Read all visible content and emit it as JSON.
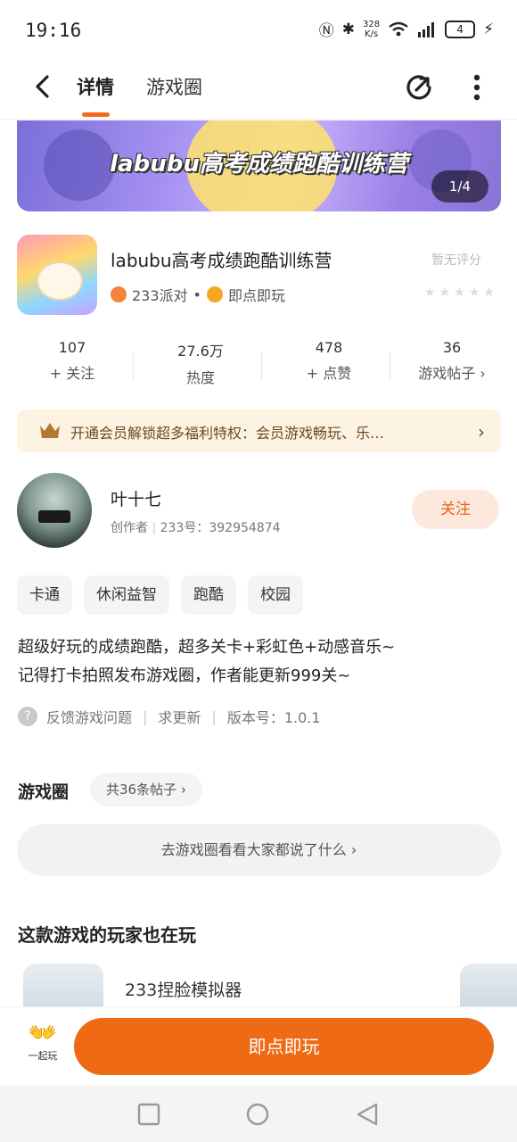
{
  "status_bar": {
    "time": "19:16",
    "net_speed_value": "328",
    "net_speed_unit": "K/s",
    "battery": "4"
  },
  "nav": {
    "tab_details": "详情",
    "tab_circle": "游戏圈"
  },
  "banner": {
    "title": "labubu高考成绩跑酷训练营",
    "counter": "1/4"
  },
  "game": {
    "title": "labubu高考成绩跑酷训练营",
    "rating": "暂无评分",
    "publisher": "233派对",
    "dot": "•",
    "play_mode": "即点即玩"
  },
  "stats": [
    {
      "value": "107",
      "label": "关注",
      "prefix": "+"
    },
    {
      "value": "27.6万",
      "label": "热度",
      "prefix": ""
    },
    {
      "value": "478",
      "label": "点赞",
      "prefix": "+"
    },
    {
      "value": "36",
      "label": "游戏帖子",
      "prefix": ""
    }
  ],
  "vip": {
    "text": "开通会员解锁超多福利特权：会员游戏畅玩、乐…",
    "arrow": "›"
  },
  "author": {
    "name": "叶十七",
    "role": "创作者",
    "id_text": "233号：392954874",
    "follow_label": "关注"
  },
  "tags": [
    "卡通",
    "休闲益智",
    "跑酷",
    "校园"
  ],
  "description": {
    "line1": "超级好玩的成绩跑酷，超多关卡+彩虹色+动感音乐~",
    "line2": "记得打卡拍照发布游戏圈，作者能更新999关~"
  },
  "feedback": {
    "icon": "?",
    "report": "反馈游戏问题",
    "request_update": "求更新",
    "version": "版本号：1.0.1",
    "sep": "|"
  },
  "game_circle": {
    "header": "游戏圈",
    "count": "共36条帖子 ›",
    "link": "去游戏圈看看大家都说了什么 ›"
  },
  "also_playing": {
    "header": "这款游戏的玩家也在玩",
    "item_name": "233捏脸模拟器"
  },
  "bottom": {
    "together_label": "一起玩",
    "play_label": "即点即玩"
  },
  "colors": {
    "accent": "#ef6a14",
    "follow_bg": "#fde8dc",
    "vip_bg": "#fdf3e3"
  }
}
